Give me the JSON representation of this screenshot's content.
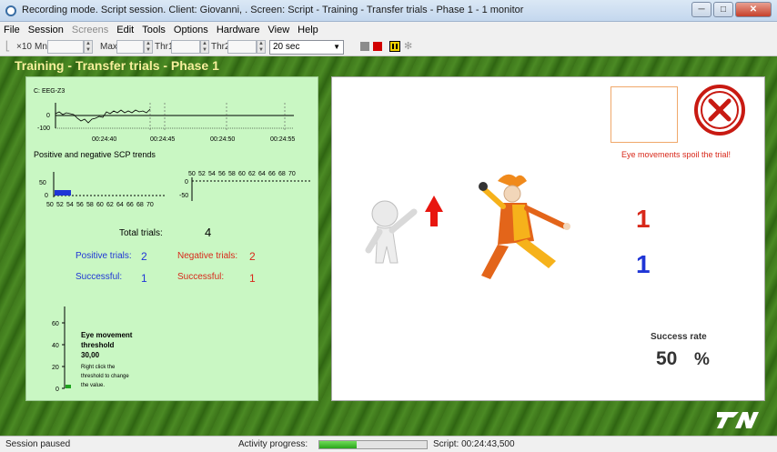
{
  "window": {
    "title": "Recording mode. Script session. Client: Giovanni, . Screen: Script - Training - Transfer trials - Phase 1 - 1 monitor",
    "minimize": "─",
    "maximize": "□",
    "close": "✕"
  },
  "menu": [
    {
      "label": "File",
      "enabled": true
    },
    {
      "label": "Session",
      "enabled": true
    },
    {
      "label": "Screens",
      "enabled": false
    },
    {
      "label": "Edit",
      "enabled": true
    },
    {
      "label": "Tools",
      "enabled": true
    },
    {
      "label": "Options",
      "enabled": true
    },
    {
      "label": "Hardware",
      "enabled": true
    },
    {
      "label": "View",
      "enabled": true
    },
    {
      "label": "Help",
      "enabled": true
    }
  ],
  "toolbar": {
    "multiplier": "×10",
    "min_label": "Mn",
    "max_label": "Max",
    "thr1_label": "Thr1",
    "thr2_label": "Thr2",
    "interval": "20 sec",
    "colors": {
      "gray": "#8c8c8c",
      "red": "#d10000",
      "yellow": "#f2d200"
    }
  },
  "page_title": "Training - Transfer trials - Phase 1",
  "left": {
    "channel": "C: EEG-Z3",
    "eeg": {
      "y_ticks": [
        "0",
        "-100"
      ],
      "x_ticks": [
        "00:24:40",
        "00:24:45",
        "00:24:50",
        "00:24:55"
      ]
    },
    "trends_title": "Positive and negative SCP trends",
    "pos_trend": {
      "y_ticks": [
        "50",
        "0"
      ],
      "x_ticks": [
        "50",
        "52",
        "54",
        "56",
        "58",
        "60",
        "62",
        "64",
        "66",
        "68",
        "70"
      ]
    },
    "neg_trend": {
      "y_ticks": [
        "0",
        "-50"
      ],
      "x_ticks": [
        "50",
        "52",
        "54",
        "56",
        "58",
        "60",
        "62",
        "64",
        "66",
        "68",
        "70"
      ]
    },
    "total_label": "Total trials:",
    "total_value": "4",
    "pos_label": "Positive trials:",
    "pos_value": "2",
    "neg_label": "Negative trials:",
    "neg_value": "2",
    "pos_succ_label": "Successful:",
    "pos_succ_value": "1",
    "neg_succ_label": "Successful:",
    "neg_succ_value": "1",
    "eye": {
      "ticks": [
        "60",
        "40",
        "20",
        "0"
      ],
      "title_line1": "Eye movement",
      "title_line2": "threshold",
      "value": "30,00",
      "hint_lines": [
        "Right click the",
        "threshold to change",
        "the value."
      ]
    },
    "colors": {
      "blue": "#1f35d6",
      "red": "#d8281a"
    }
  },
  "right": {
    "warning": "Eye movements spoil the trial!",
    "counter_red": "1",
    "counter_blue": "1",
    "success_label": "Success rate",
    "success_value": "50",
    "success_unit": "%"
  },
  "logo": "TN",
  "status": {
    "left": "Session paused",
    "activity_label": "Activity progress:",
    "activity_progress": 0.35,
    "script": "Script: 00:24:43,500"
  }
}
